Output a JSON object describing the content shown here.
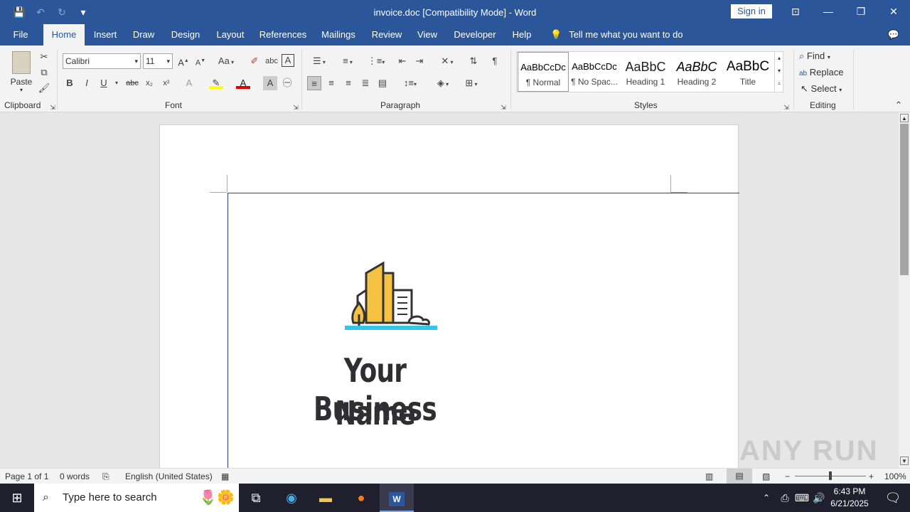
{
  "titlebar": {
    "document_title": "invoice.doc [Compatibility Mode]  -  Word",
    "sign_in": "Sign in"
  },
  "tabs": [
    "File",
    "Home",
    "Insert",
    "Draw",
    "Design",
    "Layout",
    "References",
    "Mailings",
    "Review",
    "View",
    "Developer",
    "Help"
  ],
  "tell_me": "Tell me what you want to do",
  "ribbon": {
    "clipboard": {
      "paste": "Paste",
      "label": "Clipboard"
    },
    "font": {
      "font_name": "Calibri",
      "font_size": "11",
      "label": "Font",
      "case_label": "Aa"
    },
    "paragraph": {
      "label": "Paragraph"
    },
    "styles": {
      "label": "Styles",
      "items": [
        {
          "preview": "AaBbCcDc",
          "name": "¶ Normal"
        },
        {
          "preview": "AaBbCcDc",
          "name": "¶ No Spac..."
        },
        {
          "preview": "AaBbC",
          "name": "Heading 1"
        },
        {
          "preview": "AaBbC",
          "name": "Heading 2"
        },
        {
          "preview": "AaBbC",
          "name": "Title"
        }
      ]
    },
    "editing": {
      "find": "Find",
      "replace": "Replace",
      "select": "Select",
      "label": "Editing"
    }
  },
  "document": {
    "logo_line1": "Your Business",
    "logo_line2": "Name"
  },
  "statusbar": {
    "page": "Page 1 of 1",
    "words": "0 words",
    "language": "English (United States)",
    "zoom": "100%"
  },
  "taskbar": {
    "search_placeholder": "Type here to search",
    "time": "6:43 PM",
    "date": "6/21/2025"
  },
  "watermark": "ANY RUN"
}
